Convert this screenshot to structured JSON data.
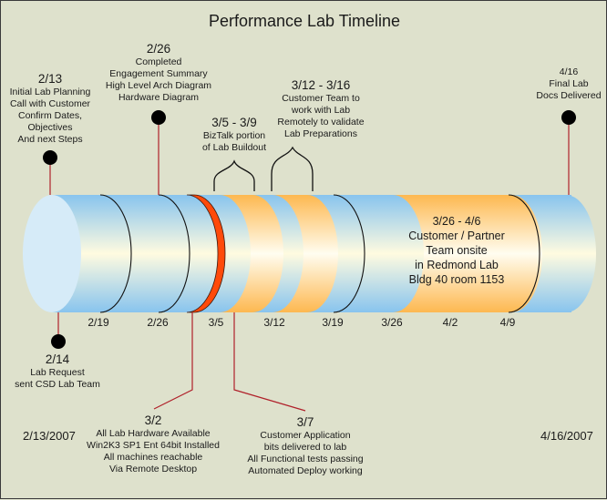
{
  "title": "Performance Lab Timeline",
  "colors": {
    "background": "#dee1cc",
    "tube_blue": "#8cc6ee",
    "tube_highlight": "#fffbe0",
    "tube_orange": "#fdbb5c",
    "milestone_red": "#ff4a0a",
    "leader_line": "#b0202a",
    "dot": "#000000"
  },
  "start_date": "2/13/2007",
  "end_date": "4/16/2007",
  "ticks": [
    "2/19",
    "2/26",
    "3/5",
    "3/12",
    "3/19",
    "3/26",
    "4/2",
    "4/9"
  ],
  "milestones_top": [
    {
      "date": "2/13",
      "lines": [
        "Initial Lab Planning",
        "Call with Customer",
        "Confirm Dates,",
        "Objectives",
        "And next Steps"
      ]
    },
    {
      "date": "2/26",
      "lines": [
        "Completed",
        "Engagement Summary",
        "High Level Arch Diagram",
        "Hardware Diagram"
      ]
    },
    {
      "date": "4/16",
      "lines": [
        "Final Lab",
        "Docs Delivered"
      ]
    }
  ],
  "ranges_top": [
    {
      "date": "3/5 - 3/9",
      "lines": [
        "BizTalk portion",
        "of Lab Buildout"
      ]
    },
    {
      "date": "3/12 - 3/16",
      "lines": [
        "Customer Team to",
        "work with Lab",
        "Remotely to validate",
        "Lab Preparations"
      ]
    }
  ],
  "milestones_bottom": [
    {
      "date": "2/14",
      "lines": [
        "Lab Request",
        "sent CSD Lab Team"
      ]
    },
    {
      "date": "3/2",
      "lines": [
        "All Lab Hardware Available",
        "Win2K3 SP1 Ent 64bit Installed",
        "All machines reachable",
        "Via Remote Desktop"
      ]
    },
    {
      "date": "3/7",
      "lines": [
        "Customer Application",
        "bits delivered to lab",
        "All Functional tests passing",
        "Automated Deploy working"
      ]
    }
  ],
  "onsite": {
    "date": "3/26 - 4/6",
    "lines": [
      "Customer / Partner",
      "Team onsite",
      "in Redmond Lab",
      "Bldg 40 room 1153"
    ]
  }
}
